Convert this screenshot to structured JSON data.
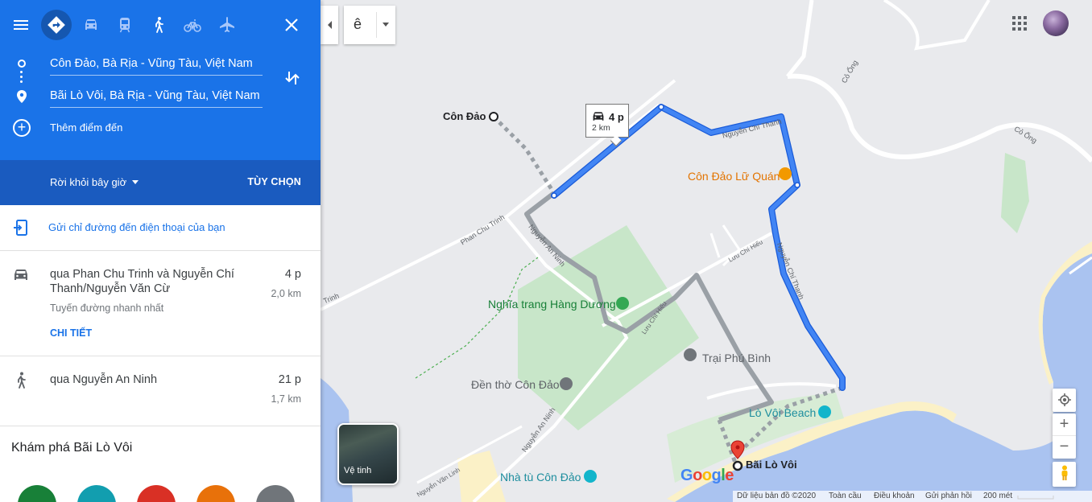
{
  "directions": {
    "origin": "Côn Đảo, Bà Rịa - Vũng Tàu, Việt Nam",
    "destination": "Bãi Lò Vôi, Bà Rịa - Vũng Tàu, Việt Nam",
    "add_destination": "Thêm điểm đến",
    "depart": "Rời khỏi bây giờ",
    "options": "TÙY CHỌN",
    "send_to_phone": "Gửi chỉ đường đến điện thoại của bạn",
    "modes": [
      "menu-icon",
      "directions-icon",
      "car-icon",
      "transit-icon",
      "walk-icon",
      "bike-icon",
      "flight-icon",
      "close-icon"
    ]
  },
  "trips": [
    {
      "mode": "car-icon",
      "via": "qua Phan Chu Trinh và Nguyễn Chí Thanh/Nguyễn Văn Cừ",
      "time": "4 p",
      "distance": "2,0 km",
      "note": "Tuyến đường nhanh nhất",
      "detail": "CHI TIẾT"
    },
    {
      "mode": "walk-icon",
      "via": "qua Nguyễn An Ninh",
      "time": "21 p",
      "distance": "1,7 km"
    }
  ],
  "explore": {
    "title": "Khám phá Bãi Lò Vôi",
    "categories": [
      {
        "icon": "restaurant-icon",
        "color": "#188038"
      },
      {
        "icon": "hotel-icon",
        "color": "#129eaf"
      },
      {
        "icon": "gas-station-icon",
        "color": "#d93025"
      },
      {
        "icon": "parking-icon",
        "color": "#e8710a"
      },
      {
        "icon": "more-icon",
        "color": "#70757a"
      }
    ]
  },
  "map": {
    "language_glyph": "ê",
    "route_box": {
      "time": "4 p",
      "distance": "2 km"
    },
    "labels": {
      "con_dao": "Côn Đảo",
      "lu_quan": "Côn Đảo Lữ Quán",
      "nghia_trang": "Nghĩa trang Hàng Dương",
      "trai_phu_binh": "Trại Phú Bình",
      "den_tho": "Đền thờ Côn Đảo",
      "lo_voi_beach": "Lò Vôi Beach",
      "bai_lo_voi": "Bãi Lò Vôi",
      "nha_tu": "Nhà tù Côn Đảo",
      "road_phan_chu_trinh": "Phan Chu Trinh",
      "road_trinh": "Trinh",
      "road_nguyen_an_ninh_1": "Nguyễn An Ninh",
      "road_nguyen_an_ninh_2": "Nguyễn An Ninh",
      "road_nguyen_chi_thanh_1": "Nguyễn Chí Thanh",
      "road_nguyen_chi_thanh_2": "Nguyễn Chí Thanh",
      "road_luu_chi_hieu_1": "Lưu Chí Hiếu",
      "road_luu_chi_hieu_2": "Lưu Chí Hiếu",
      "road_co_ong_1": "Cỏ Ống",
      "road_co_ong_2": "Cỏ Ống",
      "road_nguyen_van_linh": "Nguyễn Văn Linh"
    },
    "satellite_label": "Vệ tinh",
    "footer": {
      "data": "Dữ liệu bản đồ ©2020",
      "global": "Toàn cầu",
      "terms": "Điều khoản",
      "feedback": "Gửi phản hồi",
      "scale": "200 mét"
    },
    "google_letters": [
      "G",
      "o",
      "o",
      "g",
      "l",
      "e"
    ],
    "colors": {
      "route": "#4285f4",
      "water": "#aac3f0",
      "park": "#c8e6c9",
      "beach": "#fbf1c7"
    }
  }
}
